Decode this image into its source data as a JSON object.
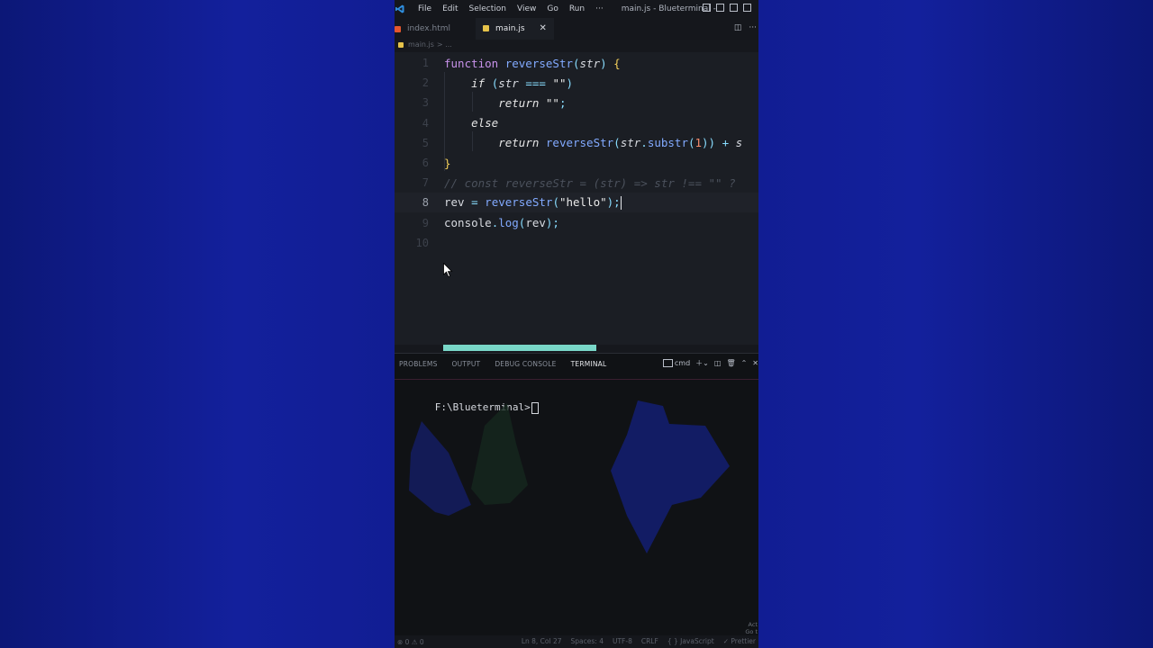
{
  "titlebar": {
    "menu": [
      "File",
      "Edit",
      "Selection",
      "View",
      "Go",
      "Run",
      "···"
    ],
    "title": "main.js - Blueterminal - Visual ..."
  },
  "tabs": [
    {
      "label": "index.html",
      "icon": "html-file-icon",
      "active": false
    },
    {
      "label": "main.js",
      "icon": "js-file-icon",
      "active": true,
      "close": "✕"
    }
  ],
  "breadcrumb": {
    "file": "main.js",
    "sep": "> ..."
  },
  "editor": {
    "current_line": 8,
    "line_numbers": [
      "1",
      "2",
      "3",
      "4",
      "5",
      "6",
      "7",
      "8",
      "9",
      "10"
    ],
    "lines": [
      [
        [
          "kw",
          "function "
        ],
        [
          "fn",
          "reverseStr"
        ],
        [
          "punc",
          "("
        ],
        [
          "param",
          "str"
        ],
        [
          "punc",
          ") "
        ],
        [
          "brace",
          "{"
        ]
      ],
      [
        [
          "plain",
          "    "
        ],
        [
          "ctrl",
          "if "
        ],
        [
          "punc",
          "("
        ],
        [
          "param",
          "str "
        ],
        [
          "punc",
          "=== "
        ],
        [
          "str",
          "\"\""
        ],
        [
          "punc",
          ")"
        ]
      ],
      [
        [
          "plain",
          "        "
        ],
        [
          "ctrl",
          "return "
        ],
        [
          "str",
          "\"\""
        ],
        [
          "punc",
          ";"
        ]
      ],
      [
        [
          "plain",
          "    "
        ],
        [
          "ctrl",
          "else"
        ]
      ],
      [
        [
          "plain",
          "        "
        ],
        [
          "ctrl",
          "return "
        ],
        [
          "fn",
          "reverseStr"
        ],
        [
          "punc",
          "("
        ],
        [
          "param",
          "str"
        ],
        [
          "punc",
          "."
        ],
        [
          "fn",
          "substr"
        ],
        [
          "punc",
          "("
        ],
        [
          "num",
          "1"
        ],
        [
          "punc",
          ")) + "
        ],
        [
          "param",
          "s"
        ]
      ],
      [
        [
          "brace",
          "}"
        ]
      ],
      [
        [
          "comment",
          "// const reverseStr = (str) => str !== \"\" ? "
        ]
      ],
      [
        [
          "plain",
          "rev "
        ],
        [
          "punc",
          "= "
        ],
        [
          "fn",
          "reverseStr"
        ],
        [
          "punc",
          "("
        ],
        [
          "str",
          "\"hello\""
        ],
        [
          "punc",
          ");"
        ]
      ],
      [
        [
          "plain",
          "console"
        ],
        [
          "punc",
          "."
        ],
        [
          "fn",
          "log"
        ],
        [
          "punc",
          "("
        ],
        [
          "plain",
          "rev"
        ],
        [
          "punc",
          ");"
        ]
      ],
      []
    ]
  },
  "panel": {
    "tabs": [
      "PROBLEMS",
      "OUTPUT",
      "DEBUG CONSOLE",
      "TERMINAL"
    ],
    "active_tab": "TERMINAL",
    "shell": "cmd",
    "prompt": "F:\\Blueterminal>"
  },
  "statusbar": {
    "errors": "⊗ 0 ⚠ 0",
    "position": "Ln 8, Col 27",
    "spaces": "Spaces: 4",
    "encoding": "UTF-8",
    "eol": "CRLF",
    "language": "{ } JavaScript",
    "formatter": "✓ Prettier"
  },
  "watermark": "Act\nGo t",
  "colors": {
    "background": "#0e1a8c",
    "editor_bg": "#1b1e24",
    "scrollbar_accent": "#79d7c8"
  }
}
